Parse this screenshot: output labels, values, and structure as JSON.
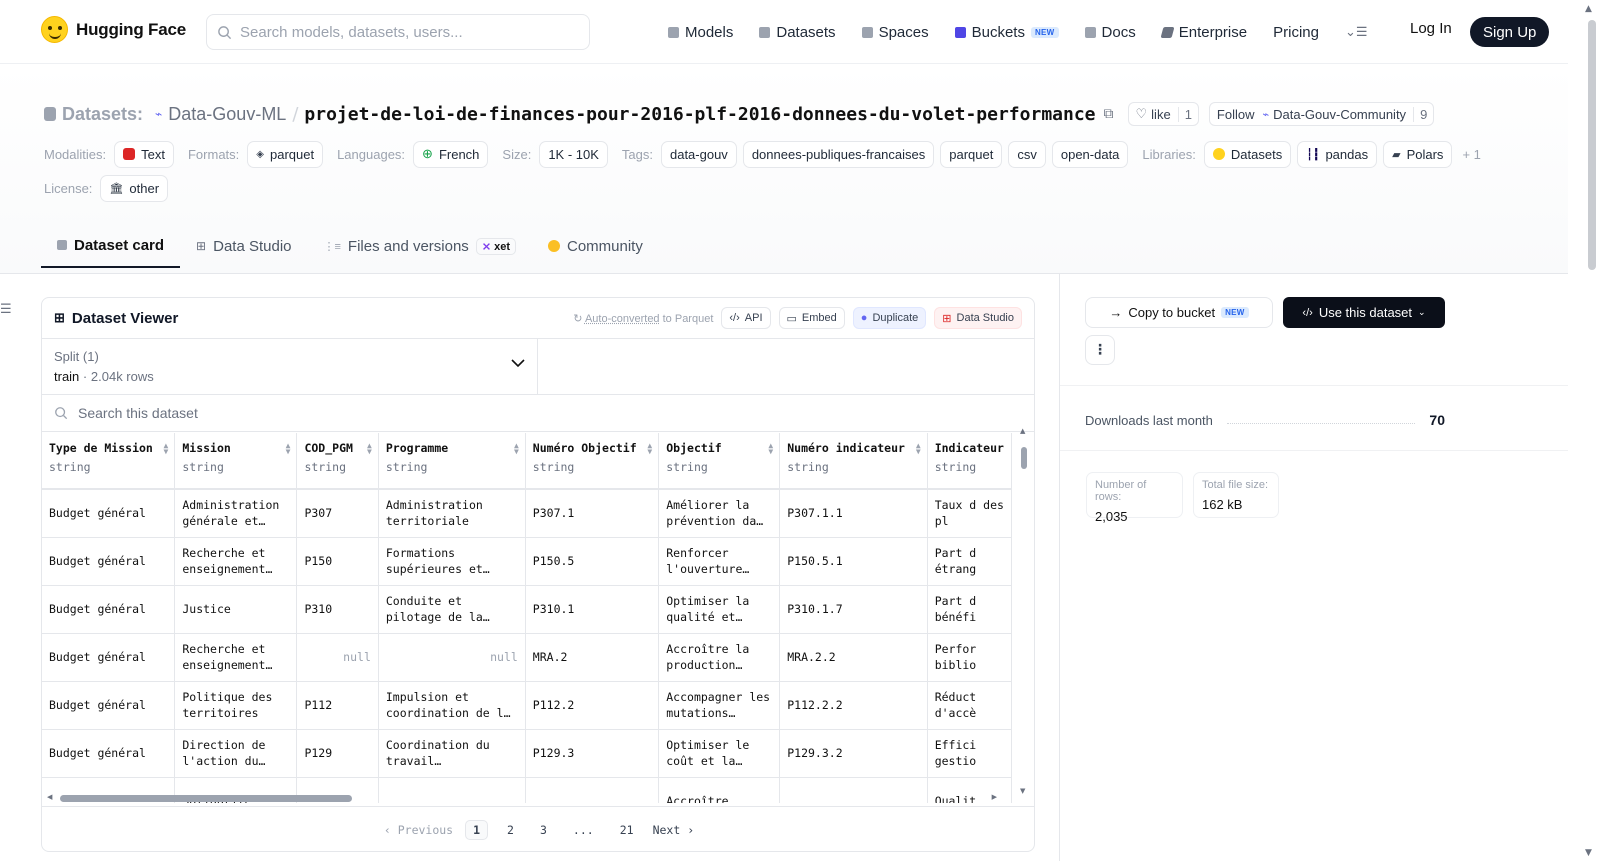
{
  "nav": {
    "brand": "Hugging Face",
    "search_placeholder": "Search models, datasets, users...",
    "items": [
      {
        "label": "Models",
        "icon": "cube-icon",
        "color": "#9ca3af"
      },
      {
        "label": "Datasets",
        "icon": "database-icon",
        "color": "#9ca3af"
      },
      {
        "label": "Spaces",
        "icon": "grid-icon",
        "color": "#9ca3af"
      },
      {
        "label": "Buckets",
        "icon": "bucket-icon",
        "color": "#4f46e5",
        "badge": "NEW"
      },
      {
        "label": "Docs",
        "icon": "book-icon",
        "color": "#9ca3af"
      },
      {
        "label": "Enterprise",
        "icon": "enterprise-icon",
        "color": "#6b7280"
      },
      {
        "label": "Pricing"
      }
    ],
    "login": "Log In",
    "signup": "Sign Up"
  },
  "header": {
    "section_label": "Datasets:",
    "owner": "Data-Gouv-ML",
    "name": "projet-de-loi-de-finances-pour-2016-plf-2016-donnees-du-volet-performance",
    "like_label": "like",
    "like_count": "1",
    "follow_label": "Follow",
    "follow_org": "Data-Gouv-Community",
    "follow_count": "9"
  },
  "tags": {
    "modalities_label": "Modalities:",
    "modality": "Text",
    "formats_label": "Formats:",
    "format": "parquet",
    "languages_label": "Languages:",
    "language": "French",
    "size_label": "Size:",
    "size": "1K - 10K",
    "tags_label": "Tags:",
    "tag_items": [
      "data-gouv",
      "donnees-publiques-francaises",
      "parquet",
      "csv",
      "open-data"
    ],
    "libraries_label": "Libraries:",
    "libraries": [
      "Datasets",
      "pandas",
      "Polars"
    ],
    "libraries_more": "+ 1",
    "license_label": "License:",
    "license": "other"
  },
  "tabs": [
    {
      "label": "Dataset card"
    },
    {
      "label": "Data Studio"
    },
    {
      "label": "Files and versions",
      "badge": "xet"
    },
    {
      "label": "Community"
    }
  ],
  "viewer": {
    "title": "Dataset Viewer",
    "auto_converted": "Auto-converted",
    "to_parquet": "to Parquet",
    "api": "API",
    "embed": "Embed",
    "duplicate": "Duplicate",
    "data_studio": "Data Studio",
    "split_label": "Split (1)",
    "split_value": "train",
    "split_rows": "2.04k rows",
    "search_placeholder": "Search this dataset",
    "columns": [
      {
        "name": "Type de Mission",
        "type": "string"
      },
      {
        "name": "Mission",
        "type": "string"
      },
      {
        "name": "COD_PGM",
        "type": "string"
      },
      {
        "name": "Programme",
        "type": "string"
      },
      {
        "name": "Numéro Objectif",
        "type": "string"
      },
      {
        "name": "Objectif",
        "type": "string"
      },
      {
        "name": "Numéro indicateur",
        "type": "string"
      },
      {
        "name": "Indicateur",
        "type": "string"
      }
    ],
    "rows": [
      [
        "Budget général",
        "Administration générale et…",
        "P307",
        "Administration territoriale",
        "P307.1",
        "Améliorer la prévention da…",
        "P307.1.1",
        "Taux d des pl"
      ],
      [
        "Budget général",
        "Recherche et enseignement…",
        "P150",
        "Formations supérieures et…",
        "P150.5",
        "Renforcer l'ouverture…",
        "P150.5.1",
        "Part d étrang"
      ],
      [
        "Budget général",
        "Justice",
        "P310",
        "Conduite et pilotage de la…",
        "P310.1",
        "Optimiser la qualité et…",
        "P310.1.7",
        "Part d bénéfi"
      ],
      [
        "Budget général",
        "Recherche et enseignement…",
        "null",
        "null",
        "MRA.2",
        "Accroître la production…",
        "MRA.2.2",
        "Perfor biblio"
      ],
      [
        "Budget général",
        "Politique des territoires",
        "P112",
        "Impulsion et coordination de l…",
        "P112.2",
        "Accompagner les mutations…",
        "P112.2.2",
        "Réduct d'accè"
      ],
      [
        "Budget général",
        "Direction de l'action du…",
        "P129",
        "Coordination du travail…",
        "P129.3",
        "Optimiser le coût et la…",
        "P129.3.2",
        "Effici gestio"
      ],
      [
        "",
        "Solidarité",
        "",
        "",
        "",
        "Accroître",
        "",
        "Qualit"
      ]
    ],
    "pager": {
      "prev": "Previous",
      "pages": [
        "1",
        "2",
        "3",
        "...",
        "21"
      ],
      "next": "Next"
    }
  },
  "sidebar": {
    "copy_label": "Copy to bucket",
    "copy_badge": "NEW",
    "use_label": "Use this dataset",
    "downloads_label": "Downloads last month",
    "downloads": "70",
    "rows_label": "Number of rows:",
    "rows_value": "2,035",
    "size_label": "Total file size:",
    "size_value": "162 kB"
  }
}
